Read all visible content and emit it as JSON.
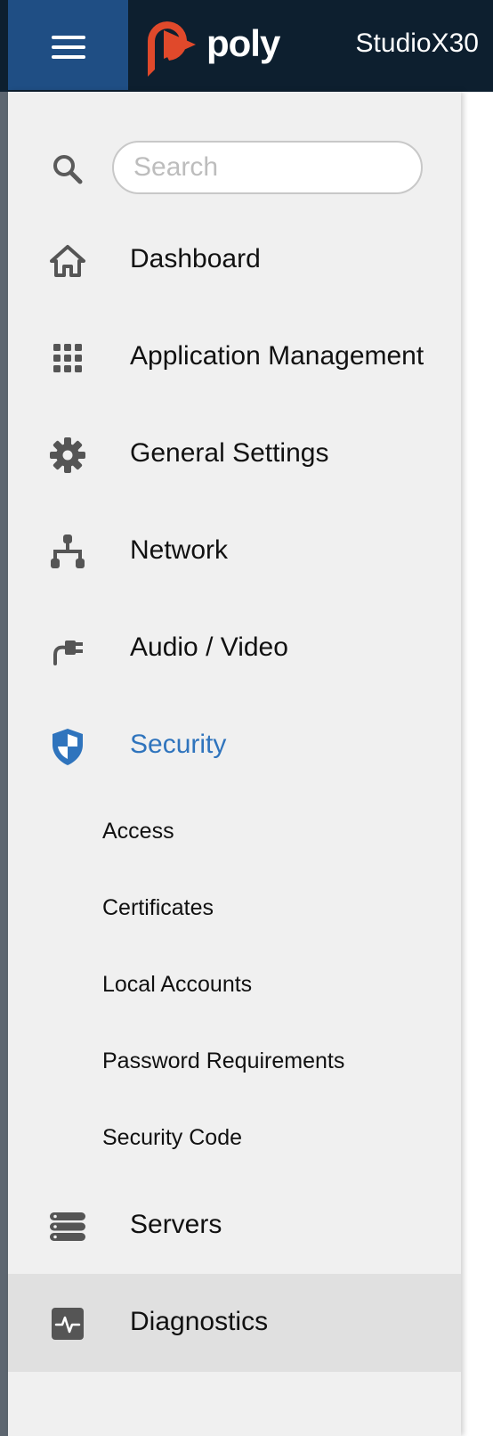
{
  "header": {
    "brand": "poly",
    "model": "StudioX30",
    "menu_icon": "hamburger-menu-icon",
    "logo_color": "#e0492b",
    "bar_color": "#0d1f2f",
    "menu_button_color": "#1f4e84"
  },
  "search": {
    "placeholder": "Search",
    "value": "",
    "icon": "search-icon"
  },
  "nav": {
    "dashboard": {
      "label": "Dashboard",
      "icon": "home-icon"
    },
    "application_management": {
      "label": "Application Management",
      "icon": "grid-icon"
    },
    "general_settings": {
      "label": "General Settings",
      "icon": "gear-icon"
    },
    "network": {
      "label": "Network",
      "icon": "network-icon"
    },
    "audio_video": {
      "label": "Audio / Video",
      "icon": "plug-icon"
    },
    "security": {
      "label": "Security",
      "icon": "shield-icon",
      "active": true,
      "accent_color": "#2f74bd",
      "children": [
        {
          "label": "Access"
        },
        {
          "label": "Certificates"
        },
        {
          "label": "Local Accounts"
        },
        {
          "label": "Password Requirements"
        },
        {
          "label": "Security Code"
        }
      ]
    },
    "servers": {
      "label": "Servers",
      "icon": "server-icon"
    },
    "diagnostics": {
      "label": "Diagnostics",
      "icon": "pulse-icon",
      "highlighted": true
    }
  }
}
